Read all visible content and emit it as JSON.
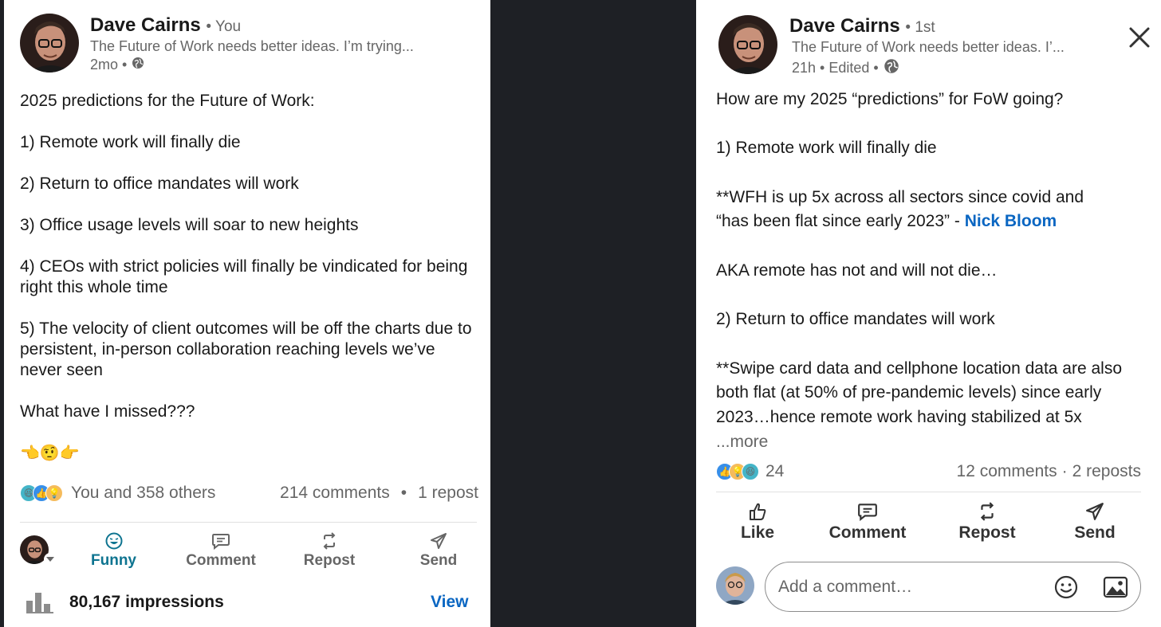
{
  "left_post": {
    "author_name": "Dave Cairns",
    "author_relation": "• You",
    "headline": "The Future of Work needs better ideas. I’m trying...",
    "meta_time": "2mo •",
    "body": [
      "2025 predictions for the Future of Work:",
      "1) Remote work will finally die",
      "2) Return to office mandates will work",
      "3) Office usage levels will soar to new heights",
      "4) CEOs with strict policies will finally be vindicated for being right this whole time",
      "5) The velocity of client outcomes will be off the charts due to persistent, in-person collaboration reaching levels we’ve never seen",
      "What have I missed???",
      "👈🤨👉"
    ],
    "reactions_text": "You and 358 others",
    "comments": "214 comments",
    "reposts": "1 repost",
    "actions": [
      "Funny",
      "Comment",
      "Repost",
      "Send"
    ],
    "impressions": "80,167 impressions",
    "view_label": "View"
  },
  "right_post": {
    "author_name": "Dave Cairns",
    "author_relation": "• 1st",
    "headline": "The Future of Work needs better ideas. I’...",
    "meta_time": "21h • Edited •",
    "body_lines": {
      "intro": "How are my 2025 “predictions” for FoW going?",
      "p1": "1) Remote work will finally die",
      "p2_a": "**WFH is up 5x across all sectors since covid and",
      "p2_b": "“has been flat since early 2023” -",
      "p2_link": "Nick Bloom",
      "p3": "AKA remote has not and will not die…",
      "p4": "2) Return to office mandates will work",
      "p5": "**Swipe card data and cellphone location data are also both flat (at 50% of pre-pandemic levels) since early 2023…hence remote work having stabilized at 5x",
      "more": "...more"
    },
    "reaction_count": "24",
    "comments": "12 comments",
    "reposts": "2 reposts",
    "actions": [
      "Like",
      "Comment",
      "Repost",
      "Send"
    ],
    "comment_placeholder": "Add a comment…"
  },
  "colors": {
    "linkedin_blue": "#0a66c2",
    "funny_teal": "#0e7490",
    "divider_bg": "#1e2025"
  }
}
